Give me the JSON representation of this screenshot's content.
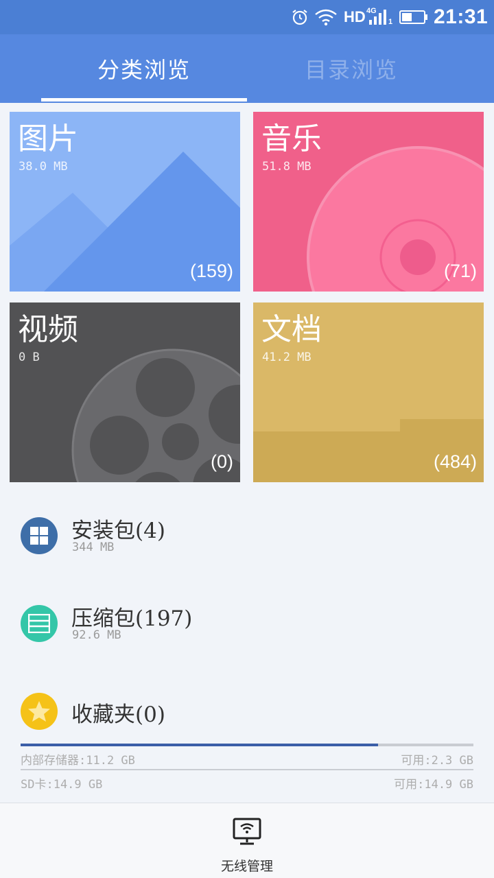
{
  "status_bar": {
    "network": "HD",
    "network_gen": "4G",
    "sim_slot": "1",
    "time": "21:31",
    "battery_level": 0.45,
    "icons": [
      "alarm-icon",
      "wifi-icon",
      "signal-icon",
      "battery-icon"
    ]
  },
  "tabs": [
    {
      "label": "分类浏览",
      "active": true
    },
    {
      "label": "目录浏览",
      "active": false
    }
  ],
  "categories": [
    {
      "title": "图片",
      "size": "38.0 MB",
      "count": "(159)",
      "color": "#8cb5f6"
    },
    {
      "title": "音乐",
      "size": "51.8 MB",
      "count": "(71)",
      "color": "#f0608a"
    },
    {
      "title": "视频",
      "size": "0 B",
      "count": "(0)",
      "color": "#525254"
    },
    {
      "title": "文档",
      "size": "41.2 MB",
      "count": "(484)",
      "color": "#dab867"
    }
  ],
  "list": [
    {
      "title": "安装包(4)",
      "subtitle": "344 MB",
      "icon": "apps-grid-icon",
      "color": "#3e6ea8"
    },
    {
      "title": "压缩包(197)",
      "subtitle": "92.6 MB",
      "icon": "archive-icon",
      "color": "#34c6a8"
    },
    {
      "title": "收藏夹(0)",
      "icon": "star-icon",
      "color": "#f5c218"
    }
  ],
  "storage": {
    "internal_label": "内部存储器:11.2 GB",
    "internal_free": "可用:2.3 GB",
    "internal_used_fraction": 0.79,
    "sd_label": "SD卡:14.9 GB",
    "sd_free": "可用:14.9 GB"
  },
  "bottom_bar": {
    "label": "无线管理",
    "icon": "wireless-monitor-icon"
  }
}
